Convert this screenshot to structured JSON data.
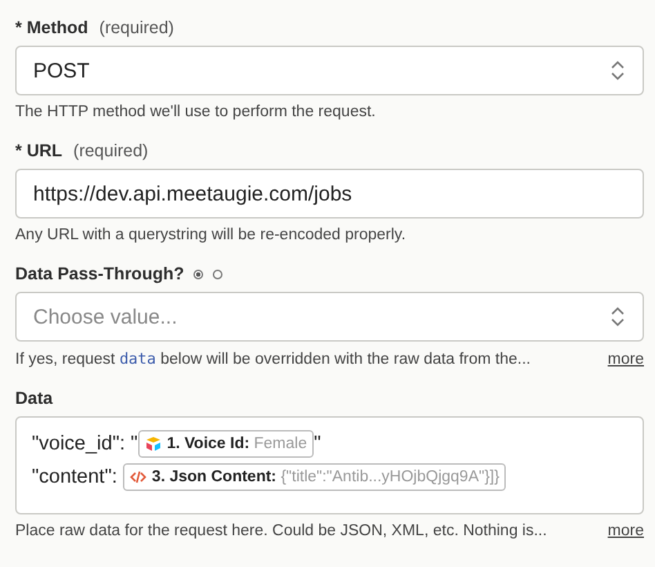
{
  "fields": [
    {
      "kind": "select",
      "label": "* Method",
      "hint": "(required)",
      "value": "POST",
      "help": [
        {
          "kind": "text",
          "text": "The HTTP method we'll use to perform the request."
        }
      ]
    },
    {
      "kind": "input",
      "label": "* URL",
      "hint": "(required)",
      "value": "https://dev.api.meetaugie.com/jobs",
      "help": [
        {
          "kind": "text",
          "text": "Any URL with a querystring will be re-encoded properly."
        }
      ]
    },
    {
      "kind": "select",
      "label": "Data Pass-Through?",
      "radios": [
        {
          "selected": true
        },
        {
          "selected": false
        }
      ],
      "placeholder": "Choose value...",
      "help": [
        {
          "kind": "text",
          "text": "If yes, request "
        },
        {
          "kind": "code",
          "text": "data"
        },
        {
          "kind": "text",
          "text": " below will be overridden with the raw data from the..."
        }
      ],
      "more": "more"
    },
    {
      "kind": "textarea",
      "label": "Data",
      "lines": [
        {
          "parts": [
            {
              "kind": "text",
              "text": "\"voice_id\": \""
            },
            {
              "kind": "app_pill",
              "label": "1. Voice Id:",
              "value": "Female"
            },
            {
              "kind": "text",
              "text": "\""
            }
          ]
        },
        {
          "parts": [
            {
              "kind": "text",
              "text": "\"content\": "
            },
            {
              "kind": "code_pill",
              "label": "3. Json Content:",
              "value": "{\"title\":\"Antib...yHOjbQjgq9A\"}]}"
            }
          ]
        }
      ],
      "help": [
        {
          "kind": "text",
          "text": "Place raw data for the request here. Could be JSON, XML, etc. Nothing is..."
        }
      ],
      "more": "more"
    }
  ]
}
